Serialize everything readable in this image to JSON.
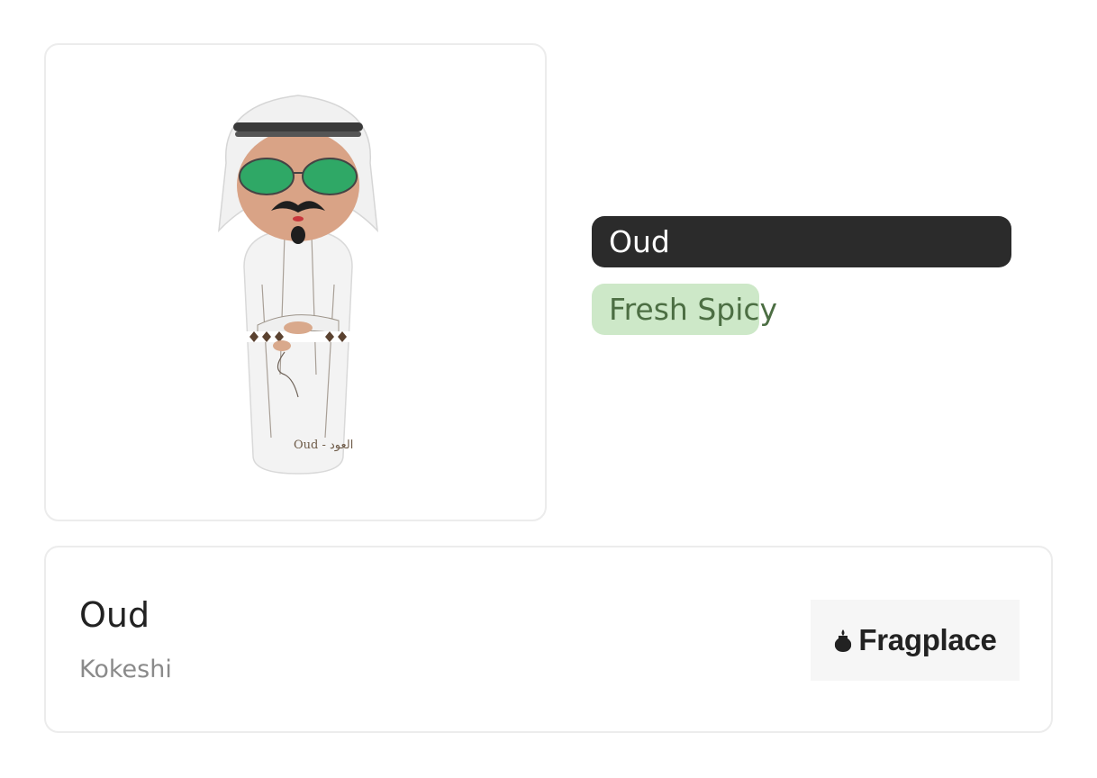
{
  "product": {
    "image_alt": "Kokeshi doll perfume bottle wearing ghutra and green aviator sunglasses",
    "name": "Oud",
    "brand": "Kokeshi"
  },
  "accords": [
    {
      "label": "Oud",
      "strength": 1.0,
      "color": "#2b2b2b",
      "text_color": "#ffffff"
    },
    {
      "label": "Fresh Spicy",
      "strength": 0.4,
      "color": "#cde8c8",
      "text_color": "#4c6e43"
    }
  ],
  "store": {
    "name": "Fragplace",
    "icon": "fragplace-logo-icon"
  }
}
